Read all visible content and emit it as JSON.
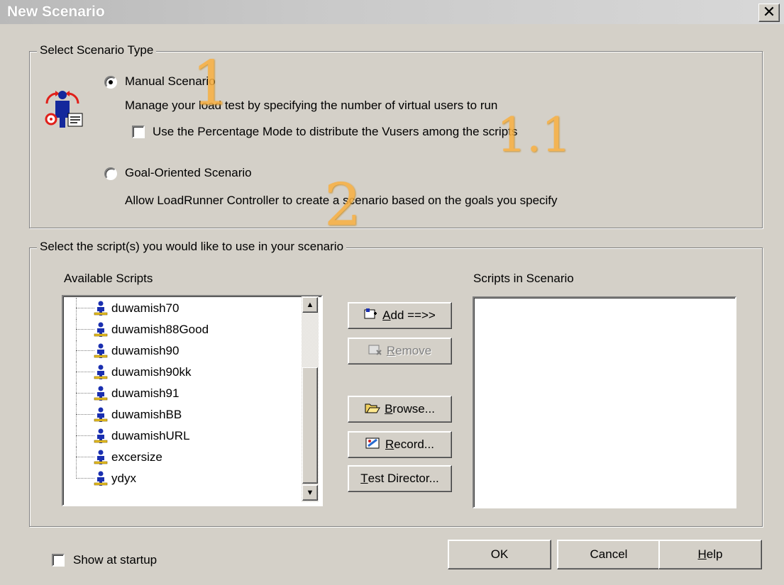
{
  "window": {
    "title": "New Scenario",
    "close_glyph": "✕"
  },
  "scenario_type": {
    "legend": "Select Scenario Type",
    "manual": {
      "label": "Manual Scenario",
      "selected": true,
      "description": "Manage your load test by specifying the number of virtual users to run"
    },
    "percentage_mode": {
      "label": "Use the Percentage Mode to distribute the Vusers among the scripts",
      "checked": false
    },
    "goal": {
      "label": "Goal-Oriented Scenario",
      "selected": false,
      "description": "Allow LoadRunner Controller to create a scenario based on the goals you specify"
    },
    "icon": "scenario-users-icon"
  },
  "annotations": {
    "one": "1",
    "one_one": "1.1",
    "two": "2"
  },
  "scripts": {
    "legend": "Select the script(s) you would like to use in your scenario",
    "available_label": "Available Scripts",
    "in_scenario_label": "Scripts in Scenario",
    "available": [
      "duwamish70",
      "duwamish88Good",
      "duwamish90",
      "duwamish90kk",
      "duwamish91",
      "duwamishBB",
      "duwamishURL",
      "excersize",
      "ydyx"
    ],
    "in_scenario": []
  },
  "buttons": {
    "add": {
      "label": "Add ==>>",
      "accel": "A",
      "icon": "add-script-icon"
    },
    "remove": {
      "label": "Remove",
      "accel": "R",
      "icon": "remove-script-icon",
      "disabled": true
    },
    "browse": {
      "label": "Browse...",
      "accel": "B",
      "icon": "folder-open-icon"
    },
    "record": {
      "label": "Record...",
      "accel": "R",
      "icon": "record-icon"
    },
    "test_director": {
      "label": "Test Director...",
      "accel": "T"
    },
    "ok": "OK",
    "cancel": "Cancel",
    "help": "Help"
  },
  "show_at_startup": {
    "label": "Show at startup",
    "checked": false
  },
  "colors": {
    "face": "#d4d0c8",
    "annotation": "#f9b040",
    "script_icon": "#1a2fb0"
  }
}
